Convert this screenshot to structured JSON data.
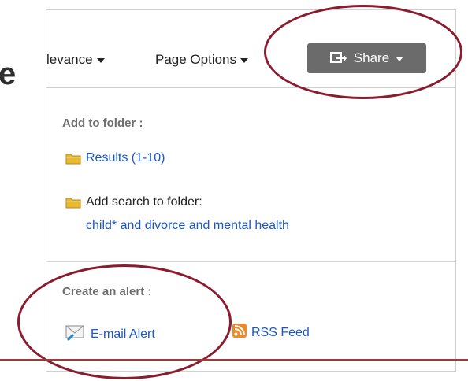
{
  "side_fragment": "e",
  "toolbar": {
    "sort_label": "levance",
    "page_options_label": "Page Options",
    "share_label": "Share"
  },
  "folder_section": {
    "heading": "Add to folder :",
    "results_link": "Results (1-10)",
    "add_search_label": "Add search to folder:",
    "search_query_link": "child* and divorce and mental health"
  },
  "alert_section": {
    "heading": "Create an alert :",
    "email_alert_link": "E-mail Alert",
    "rss_feed_link": "RSS Feed"
  },
  "colors": {
    "link": "#1a57c7",
    "share_button": "#6b6b6b",
    "annotation_ring": "#8a1c2e",
    "rss_orange": "#f08a24"
  },
  "icons": [
    "folder-icon",
    "share-icon",
    "email-icon",
    "rss-icon",
    "caret-down-icon"
  ]
}
